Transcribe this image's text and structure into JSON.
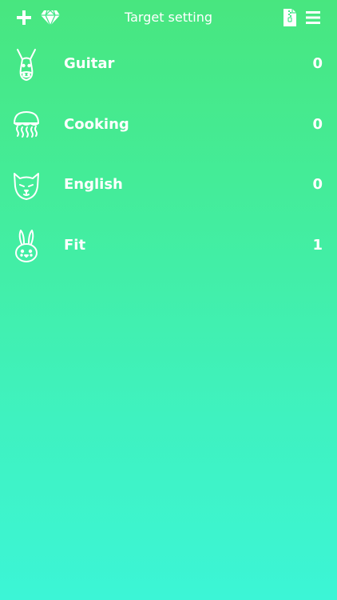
{
  "header": {
    "title": "Target setting",
    "icons": [
      "plus-icon",
      "diamond-icon",
      "zip-file-icon",
      "menu-icon"
    ]
  },
  "targets": [
    {
      "label": "Guitar",
      "count": "0",
      "icon": "donkey-icon"
    },
    {
      "label": "Cooking",
      "count": "0",
      "icon": "jellyfish-icon"
    },
    {
      "label": "English",
      "count": "0",
      "icon": "cat-icon"
    },
    {
      "label": "Fit",
      "count": "1",
      "icon": "rabbit-icon"
    }
  ],
  "colors": {
    "gradient_top": "#48e67f",
    "gradient_bottom": "#3cf5d6",
    "text": "#ffffff"
  }
}
